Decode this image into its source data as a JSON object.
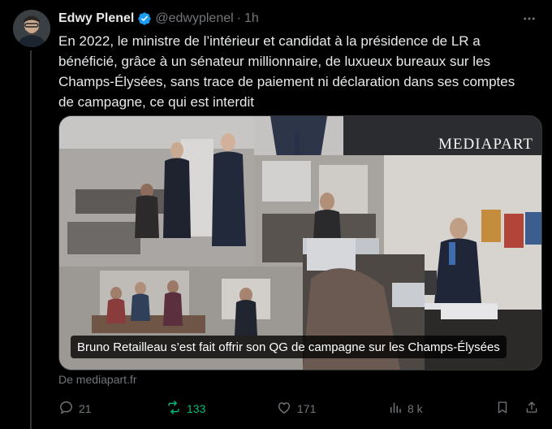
{
  "author": {
    "name": "Edwy Plenel",
    "handle": "@edwyplenel",
    "separator": "·",
    "time": "1h"
  },
  "tweet": {
    "lines": [
      "En 2022,  le ministre de l’intérieur et candidat à la présidence de LR a",
      "bénéficié, grâce à un sénateur millionnaire, de luxueux bureaux sur les",
      "Champs-Élysées, sans trace de paiement ni déclaration dans ses comptes",
      "de campagne, ce qui est interdit"
    ]
  },
  "media": {
    "caption": "Bruno Retailleau s’est fait offrir son QG de campagne sur les Champs-Élysées",
    "watermark": "MEDIAPART"
  },
  "source": {
    "label": "De mediapart.fr"
  },
  "actions": {
    "replies": "21",
    "retweets": "133",
    "likes": "171",
    "views": "8 k"
  },
  "colors": {
    "background": "#000000",
    "text": "#e7e9ea",
    "muted": "#71767b",
    "verified": "#1d9bf0",
    "retweet_active": "#00ba7c"
  },
  "icons": [
    "verified-badge-icon",
    "more-icon",
    "reply-icon",
    "retweet-icon",
    "like-icon",
    "views-icon",
    "bookmark-icon",
    "share-icon"
  ]
}
